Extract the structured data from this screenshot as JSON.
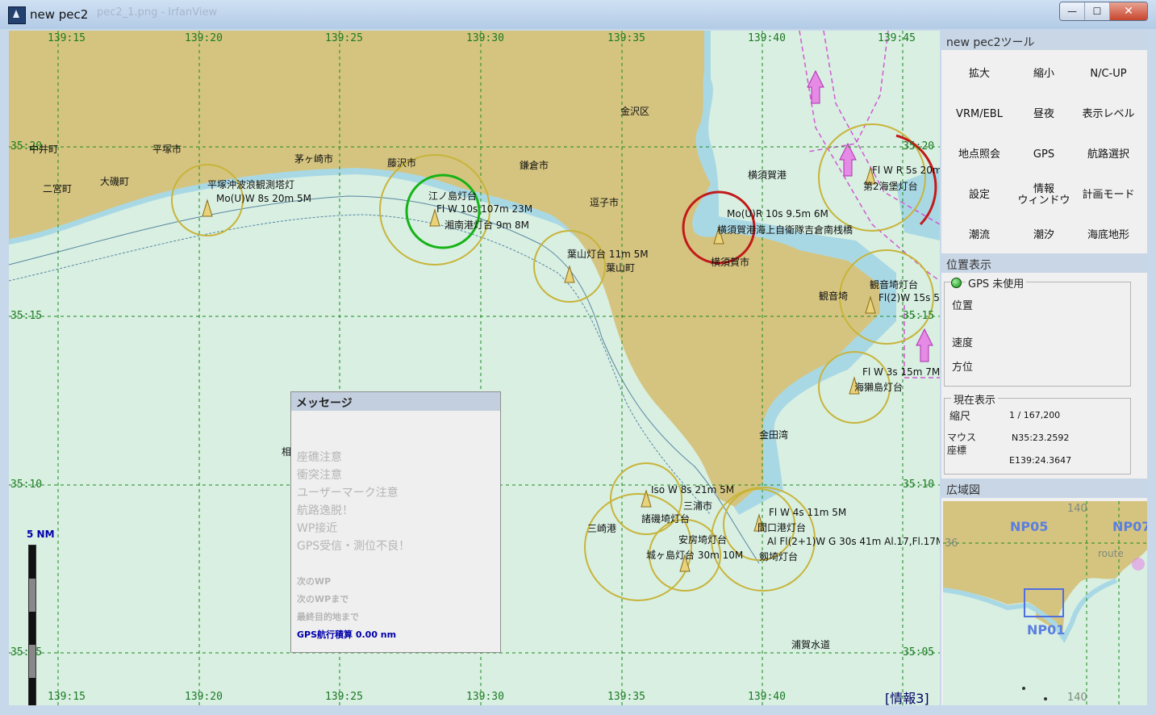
{
  "window": {
    "title": "new pec2",
    "ghost_title": "pec2_1.png - IrfanView",
    "buttons": {
      "minimize": "—",
      "maximize": "☐",
      "close": "✕"
    }
  },
  "map": {
    "ticks_top": [
      "139:15",
      "139:20",
      "139:25",
      "139:30",
      "139:35",
      "139:40",
      "139:45"
    ],
    "ticks_bottom": [
      "139:15",
      "139:20",
      "139:25",
      "139:30",
      "139:35",
      "139:40"
    ],
    "ticks_left": [
      "35:20",
      "35:15",
      "35:10",
      "35:05"
    ],
    "ticks_right": [
      "35:20",
      "35:15",
      "35:10",
      "35:05"
    ],
    "place_labels": [
      "中井町",
      "二宮町",
      "大磯町",
      "平塚市",
      "茅ヶ崎市",
      "藤沢市",
      "鎌倉市",
      "逗子市",
      "金沢区",
      "横須賀港",
      "葉山町",
      "横須賀市",
      "観音埼",
      "金田湾",
      "三浦市",
      "三崎港",
      "浦賀水道",
      "相"
    ],
    "light_labels": [
      "平塚沖波浪観測塔灯",
      "Mo(U)W 8s 20m 5M",
      "江ノ島灯台",
      "Fl W 10s 107m 23M",
      "湘南港灯台 9m 8M",
      "葉山灯台 11m 5M",
      "Mo(U)R 10s 9.5m 6M",
      "横須賀港海上自衛隊吉倉南桟橋",
      "Fl W R 5s 20m",
      "第2海堡灯台",
      "観音埼灯台",
      "Fl(2)W 15s 5",
      "Fl W 3s 15m 7M",
      "海獺島灯台",
      "Iso W 8s 21m 5M",
      "諸磯埼灯台",
      "Fl W 4s 11m 5M",
      "間口港灯台",
      "Al Fl(2+1)W G 30s 41m Al.17,Fl.17M",
      "安房埼灯台",
      "城ヶ島灯台 30m 10M",
      "剱埼灯台"
    ],
    "scale_label": "5  NM",
    "info_label": "[情報3]",
    "colors": {
      "land": "#d5c47f",
      "shoal": "#a9d8e5",
      "sea": "#d8efe2",
      "grid": "#1c8a1c",
      "ring": "#c8b43a",
      "red": "#c21a1a",
      "green": "#16b316",
      "magenta": "#d05ad0"
    }
  },
  "message": {
    "title": "メッセージ",
    "items": [
      "座礁注意",
      "衝突注意",
      "ユーザーマーク注意",
      "航路逸脱！",
      "WP接近",
      "GPS受信・測位不良！"
    ],
    "small_items": [
      "次のWP",
      "次のWPまで",
      "最終目的地まで"
    ],
    "gps_total": "GPS航行積算  0.00 nm"
  },
  "tools": {
    "title": "new pec2ツール",
    "buttons": [
      "拡大",
      "縮小",
      "N/C-UP",
      "VRM/EBL",
      "昼夜",
      "表示レベル",
      "地点照会",
      "GPS",
      "航路選択",
      "設定",
      "情報\nウィンドウ",
      "計画モード",
      "潮流",
      "潮汐",
      "海底地形"
    ]
  },
  "position": {
    "title": "位置表示",
    "gps_status": "GPS 未使用",
    "pos_label": "位置",
    "speed_label": "速度",
    "heading_label": "方位"
  },
  "current": {
    "title": "現在表示",
    "scale_label": "縮尺",
    "scale_value": "1 / 167,200",
    "mouse_label_1": "マウス",
    "mouse_label_2": "座標",
    "lat": "N35:23.2592",
    "lon": "E139:24.3647"
  },
  "overview": {
    "title": "広域図",
    "labels": [
      "NP05",
      "NP07",
      "NP01"
    ],
    "grid_labels": [
      "140",
      "36",
      "140"
    ],
    "route_label": "route"
  }
}
